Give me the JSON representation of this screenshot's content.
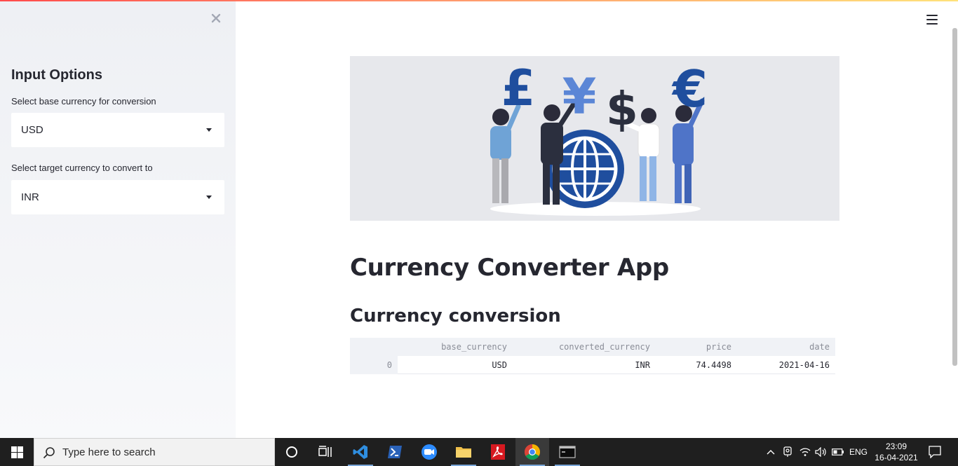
{
  "sidebar": {
    "title": "Input Options",
    "base_label": "Select base currency for conversion",
    "base_value": "USD",
    "target_label": "Select target currency to convert to",
    "target_value": "INR"
  },
  "main": {
    "app_title": "Currency Converter App",
    "subheader": "Currency conversion",
    "table": {
      "columns": [
        "base_currency",
        "converted_currency",
        "price",
        "date"
      ],
      "rows": [
        {
          "index": "0",
          "base_currency": "USD",
          "converted_currency": "INR",
          "price": "74.4498",
          "date": "2021-04-16"
        }
      ]
    },
    "hero_symbols": [
      "£",
      "¥",
      "$",
      "€"
    ]
  },
  "taskbar": {
    "search_placeholder": "Type here to search",
    "language": "ENG",
    "time": "23:09",
    "date": "16-04-2021"
  },
  "colors": {
    "accent_top": "#ff4b4b",
    "sidebar_bg": "#eef0f4",
    "text": "#262730",
    "illustration_blue": "#1f4e9e"
  }
}
